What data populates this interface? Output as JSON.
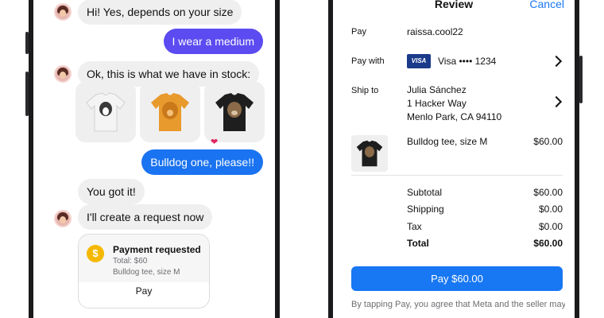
{
  "colors": {
    "accent_blue": "#1877f2",
    "bubble_out_purple": "#5b4bf0",
    "bubble_out_blue": "#1a73f0",
    "bubble_in": "#efeff0",
    "coin": "#f5b800",
    "visa": "#1a3a8a"
  },
  "chat": {
    "messages": {
      "m1": "Hi! Yes, depends on your size",
      "m2": "I wear a medium",
      "m3": "Ok, this is what we have in stock:",
      "m4": "Bulldog one, please!!",
      "m5": "You got it!",
      "m6": "I'll create a request now"
    },
    "products": [
      {
        "name": "white-border-collie-tee",
        "shirt_color": "#f4f4f4"
      },
      {
        "name": "orange-golden-retriever-tee",
        "shirt_color": "#e89a2c"
      },
      {
        "name": "black-bulldog-tee",
        "shirt_color": "#1e1e1e"
      }
    ],
    "reaction": "❤",
    "payment_card": {
      "title": "Payment requested",
      "total": "Total: $60",
      "item": "Bulldog tee, size M",
      "action": "Pay"
    }
  },
  "review": {
    "title": "Review",
    "cancel": "Cancel",
    "pay_label": "Pay",
    "pay_value": "raissa.cool22",
    "pay_with_label": "Pay with",
    "card_brand": "VISA",
    "card_value": "Visa •••• 1234",
    "ship_to_label": "Ship to",
    "ship_name": "Julia Sánchez",
    "ship_street": "1 Hacker Way",
    "ship_city": "Menlo Park, CA 94110",
    "item_name": "Bulldog tee, size M",
    "item_price": "$60.00",
    "subtotal_label": "Subtotal",
    "subtotal_value": "$60.00",
    "shipping_label": "Shipping",
    "shipping_value": "$0.00",
    "tax_label": "Tax",
    "tax_value": "$0.00",
    "total_label": "Total",
    "total_value": "$60.00",
    "pay_button": "Pay $60.00",
    "legal": "By tapping Pay, you agree that Meta and the seller may"
  }
}
